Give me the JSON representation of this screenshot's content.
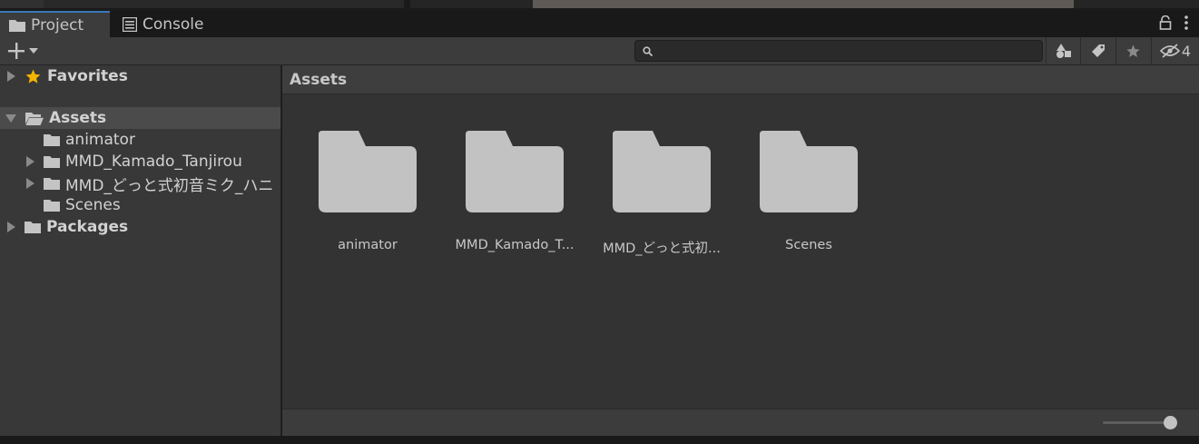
{
  "tabs": [
    {
      "label": "Project",
      "icon": "folder-icon",
      "active": true
    },
    {
      "label": "Console",
      "icon": "console-icon",
      "active": false
    }
  ],
  "toolbar": {
    "add_icon": "plus-icon",
    "search_placeholder": "",
    "hidden_packages_count": "4"
  },
  "tree": {
    "favorites": "Favorites",
    "assets": "Assets",
    "children": [
      "animator",
      "MMD_Kamado_Tanjirou",
      "MMD_どっと式初音ミク_ハニ",
      "Scenes"
    ],
    "packages": "Packages"
  },
  "breadcrumb": "Assets",
  "grid_items": [
    "animator",
    "MMD_Kamado_T...",
    "MMD_どっと式初...",
    "Scenes"
  ],
  "zoom_slider_level": 0.95,
  "colors": {
    "accent": "#3a79bb",
    "star": "#f4b400",
    "folder": "#c2c2c2"
  }
}
